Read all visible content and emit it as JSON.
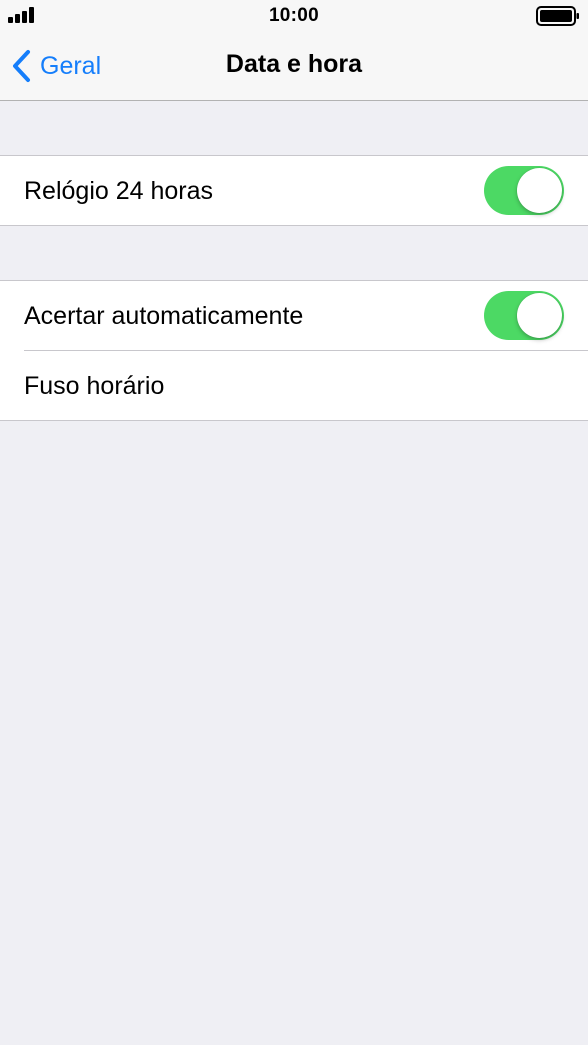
{
  "status_bar": {
    "time": "10:00",
    "signal_icon": "cellular-signal-icon",
    "battery_icon": "battery-full-icon"
  },
  "nav": {
    "back_label": "Geral",
    "back_icon": "chevron-left-icon",
    "title": "Data e hora"
  },
  "groups": [
    {
      "rows": [
        {
          "label": "Relógio 24 horas",
          "toggle": true
        }
      ]
    },
    {
      "rows": [
        {
          "label": "Acertar automaticamente",
          "toggle": true
        },
        {
          "label": "Fuso horário"
        }
      ]
    }
  ],
  "colors": {
    "accent": "#157efb",
    "toggle_on": "#4cd964",
    "background": "#efeff4"
  }
}
